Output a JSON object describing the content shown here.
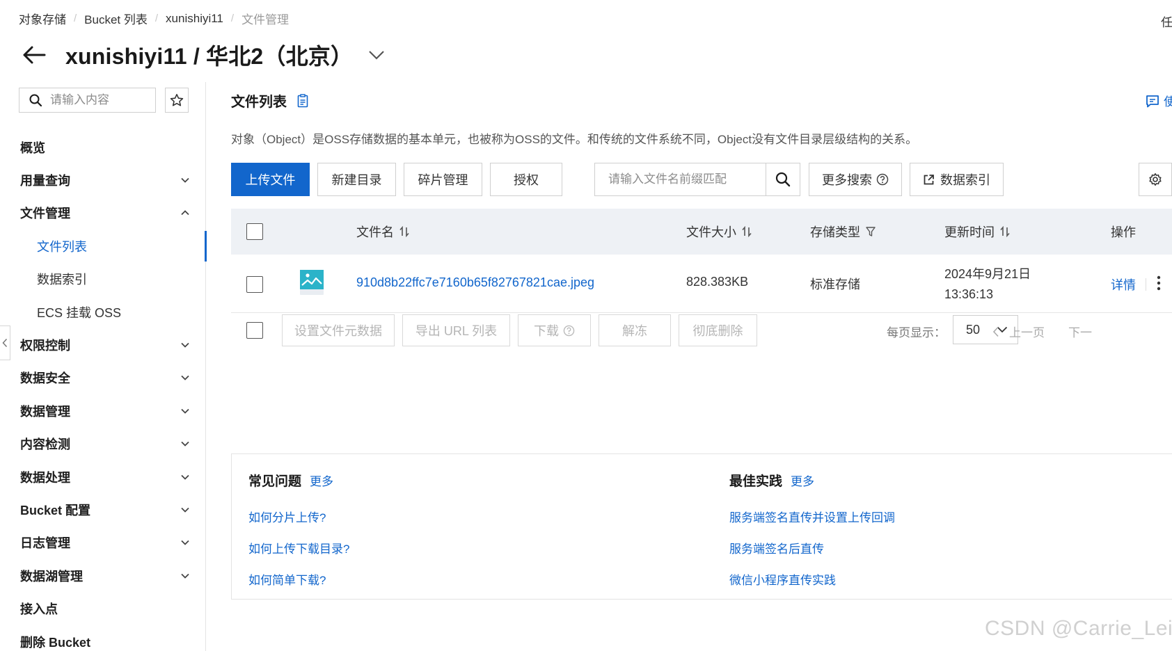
{
  "breadcrumb": [
    "对象存储",
    "Bucket 列表",
    "xunishiyi11",
    "文件管理"
  ],
  "top_right_cut": "任",
  "header": {
    "title": "xunishiyi11 / 华北2（北京）"
  },
  "sidebar": {
    "search_placeholder": "请输入内容",
    "items": [
      {
        "label": "概览",
        "chevron": "none"
      },
      {
        "label": "用量查询",
        "chevron": "down"
      },
      {
        "label": "文件管理",
        "chevron": "up"
      },
      {
        "label": "文件列表",
        "sub": true,
        "active": true
      },
      {
        "label": "数据索引",
        "sub": true
      },
      {
        "label": "ECS 挂载 OSS",
        "sub": true
      },
      {
        "label": "权限控制",
        "chevron": "down"
      },
      {
        "label": "数据安全",
        "chevron": "down"
      },
      {
        "label": "数据管理",
        "chevron": "down"
      },
      {
        "label": "内容检测",
        "chevron": "down"
      },
      {
        "label": "数据处理",
        "chevron": "down"
      },
      {
        "label": "Bucket 配置",
        "chevron": "down"
      },
      {
        "label": "日志管理",
        "chevron": "down"
      },
      {
        "label": "数据湖管理",
        "chevron": "down"
      },
      {
        "label": "接入点",
        "chevron": "none"
      },
      {
        "label": "删除 Bucket",
        "chevron": "none"
      }
    ]
  },
  "main": {
    "section_title": "文件列表",
    "help_link": "使",
    "description": "对象（Object）是OSS存储数据的基本单元，也被称为OSS的文件。和传统的文件系统不同，Object没有文件目录层级结构的关系。",
    "toolbar": {
      "upload": "上传文件",
      "new_dir": "新建目录",
      "fragments": "碎片管理",
      "authorize": "授权",
      "prefix_placeholder": "请输入文件名前缀匹配",
      "more_search": "更多搜索",
      "data_index": "数据索引"
    },
    "table": {
      "headers": {
        "name": "文件名",
        "size": "文件大小",
        "storage": "存储类型",
        "updated": "更新时间",
        "ops": "操作"
      },
      "rows": [
        {
          "name": "910d8b22ffc7e7160b65f82767821cae.jpeg",
          "size": "828.383KB",
          "storage": "标准存储",
          "date": "2024年9月21日",
          "time": "13:36:13",
          "detail": "详情"
        }
      ]
    },
    "bulk": {
      "set_meta": "设置文件元数据",
      "export_url": "导出 URL 列表",
      "download": "下载",
      "unfreeze": "解冻",
      "delete": "彻底删除",
      "per_page_label": "每页显示：",
      "per_page_value": "50",
      "prev": "上一页",
      "next": "下一"
    },
    "faq": {
      "title": "常见问题",
      "more": "更多",
      "links": [
        "如何分片上传?",
        "如何上传下载目录?",
        "如何简单下载?"
      ]
    },
    "best": {
      "title": "最佳实践",
      "more": "更多",
      "links": [
        "服务端签名直传并设置上传回调",
        "服务端签名后直传",
        "微信小程序直传实践"
      ]
    }
  },
  "watermark": "CSDN @Carrie_Lei",
  "colors": {
    "accent": "#1266cc",
    "header_bg": "#eef1f5"
  }
}
